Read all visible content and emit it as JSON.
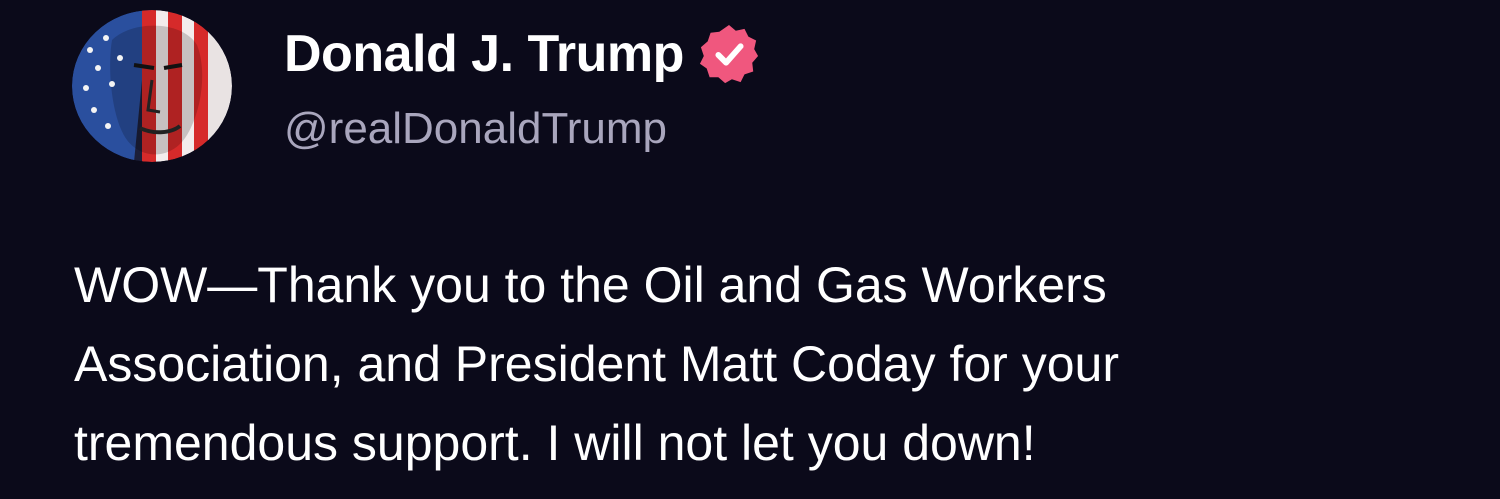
{
  "post": {
    "author": {
      "display_name": "Donald J. Trump",
      "handle": "@realDonaldTrump",
      "verified_icon": "verified-badge-icon",
      "avatar": "profile-avatar"
    },
    "body_lines": [
      "WOW—Thank you to the Oil and Gas Workers",
      "Association, and President Matt Coday for your",
      "tremendous support. I will not let you down!"
    ]
  },
  "colors": {
    "background": "#0b0a1a",
    "text_primary": "#ffffff",
    "text_secondary": "#a9a6bd",
    "verified_badge": "#f0577e"
  }
}
